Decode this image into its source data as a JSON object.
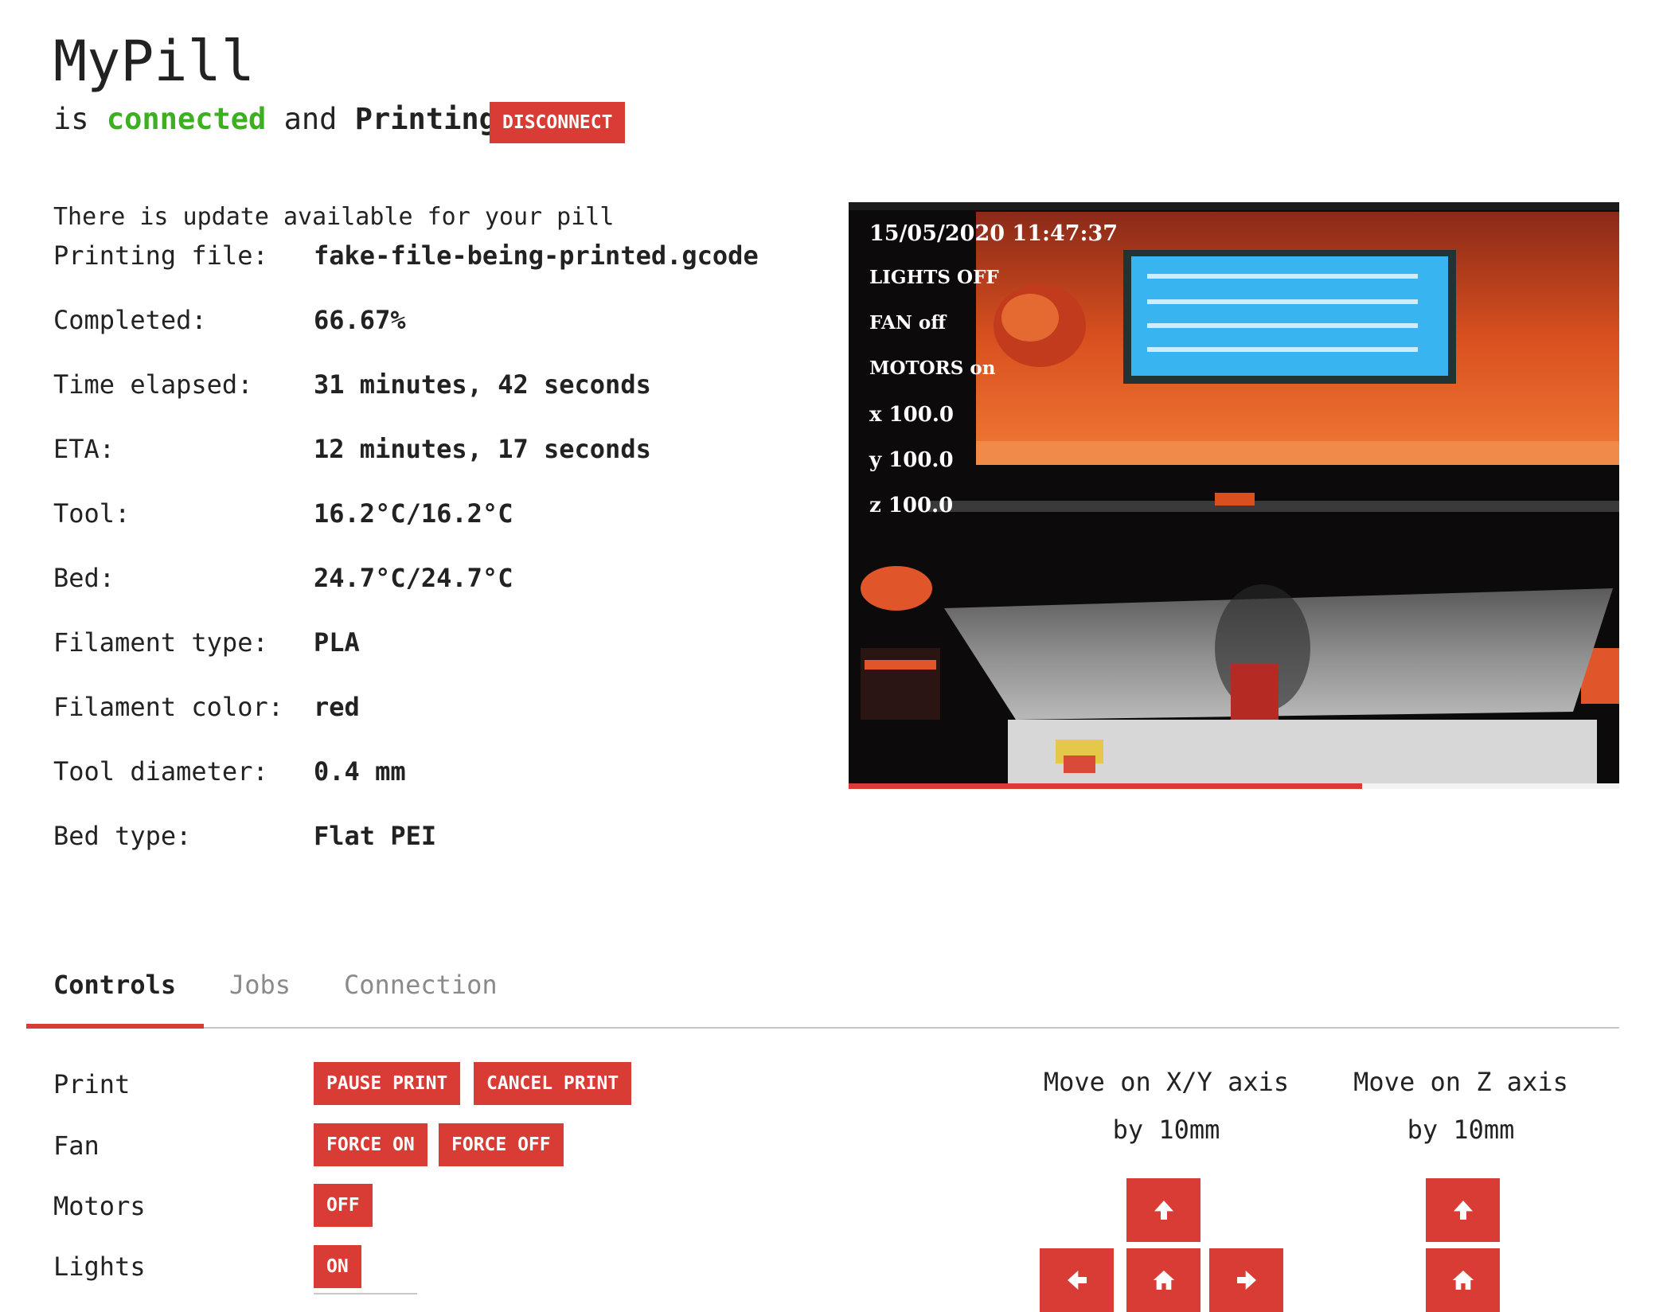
{
  "header": {
    "title": "MyPill",
    "status_prefix": "is",
    "connection": "connected",
    "status_mid": "and",
    "state": "Printing",
    "disconnect_label": "DISCONNECT"
  },
  "update_notice": "There is update available for your pill",
  "info": [
    {
      "label": "Printing file:",
      "value": "fake-file-being-printed.gcode"
    },
    {
      "label": "Completed:",
      "value": "66.67%"
    },
    {
      "label": "Time elapsed:",
      "value": "31 minutes, 42 seconds"
    },
    {
      "label": "ETA:",
      "value": "12 minutes, 17 seconds"
    },
    {
      "label": "Tool:",
      "value": "16.2°C/16.2°C"
    },
    {
      "label": "Bed:",
      "value": "24.7°C/24.7°C"
    },
    {
      "label": "Filament type:",
      "value": "PLA"
    },
    {
      "label": "Filament color:",
      "value": "red"
    },
    {
      "label": "Tool diameter:",
      "value": "0.4 mm"
    },
    {
      "label": "Bed type:",
      "value": "Flat PEI"
    }
  ],
  "camera": {
    "overlay": {
      "timestamp": "15/05/2020 11:47:37",
      "lights": "LIGHTS OFF",
      "fan": "FAN off",
      "motors": "MOTORS on",
      "x": "x 100.0",
      "y": "y 100.0",
      "z": "z 100.0"
    },
    "progress_fraction": 0.6667,
    "colors": {
      "frame": "#c8401c",
      "lcd": "#38b4f0"
    }
  },
  "tabs": [
    {
      "label": "Controls",
      "active": true
    },
    {
      "label": "Jobs",
      "active": false
    },
    {
      "label": "Connection",
      "active": false
    }
  ],
  "controls": {
    "print": {
      "label": "Print",
      "pause": "PAUSE PRINT",
      "cancel": "CANCEL PRINT"
    },
    "fan": {
      "label": "Fan",
      "force_on": "FORCE ON",
      "force_off": "FORCE OFF"
    },
    "motors": {
      "label": "Motors",
      "toggle": "OFF"
    },
    "lights": {
      "label": "Lights",
      "toggle": "ON"
    }
  },
  "movement": {
    "xy_title": "Move on X/Y axis",
    "xy_step": "by 10mm",
    "z_title": "Move on Z axis",
    "z_step": "by 10mm",
    "icons": [
      "arrow-up-icon",
      "arrow-left-icon",
      "home-icon",
      "arrow-right-icon"
    ]
  },
  "colors": {
    "accent": "#d93b35",
    "connected": "#3cb020",
    "text": "#222222",
    "muted": "#8a8a8a"
  }
}
